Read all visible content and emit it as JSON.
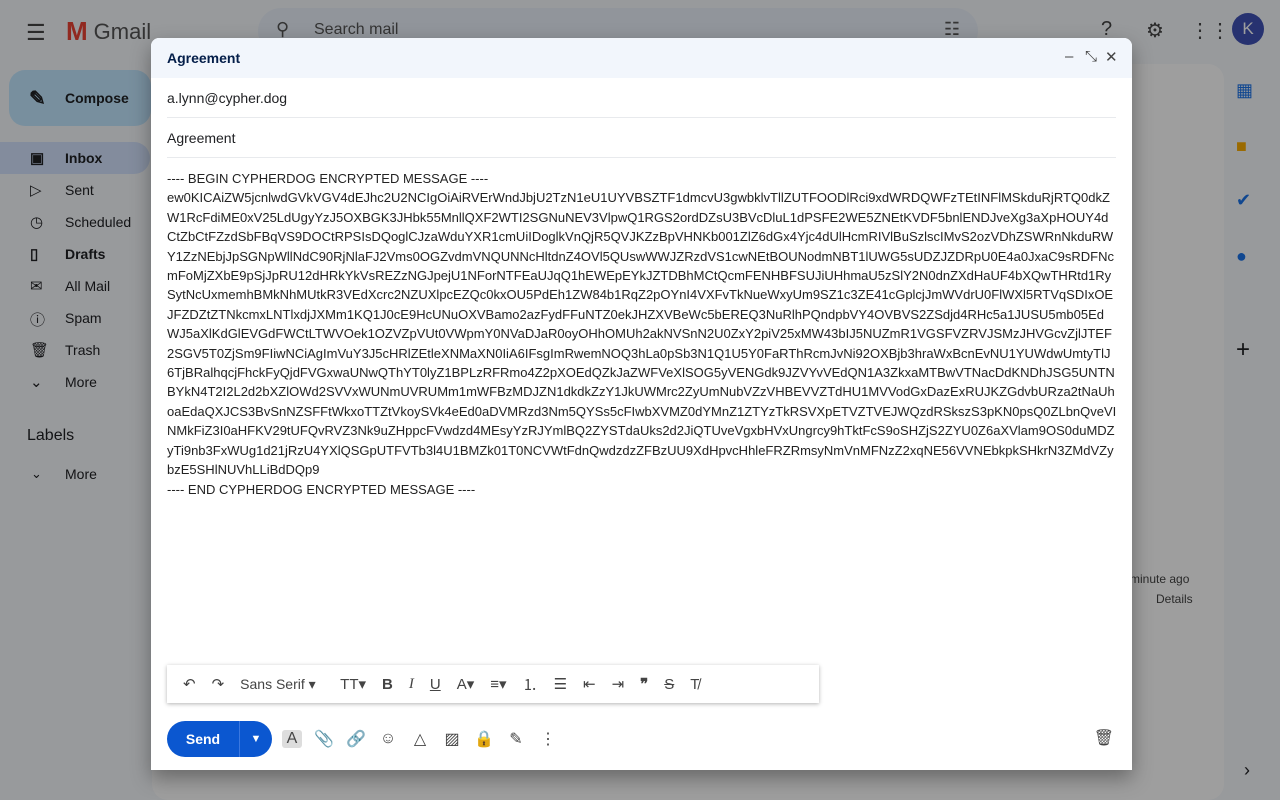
{
  "header": {
    "app_name": "Gmail",
    "search_placeholder": "Search mail",
    "avatar_letter": "K"
  },
  "sidebar": {
    "compose": "Compose",
    "items": [
      {
        "label": "Inbox",
        "icon": "inbox-icon"
      },
      {
        "label": "Sent",
        "icon": "send-icon"
      },
      {
        "label": "Scheduled",
        "icon": "schedule-icon"
      },
      {
        "label": "Drafts",
        "icon": "draft-icon"
      },
      {
        "label": "All Mail",
        "icon": "mail-icon"
      },
      {
        "label": "Spam",
        "icon": "spam-icon"
      },
      {
        "label": "Trash",
        "icon": "trash-icon"
      },
      {
        "label": "More",
        "icon": "chevron-down-icon"
      }
    ],
    "labels_title": "Labels",
    "labels_more": "More"
  },
  "background": {
    "time": "minute ago",
    "details": "Details"
  },
  "compose": {
    "title": "Agreement",
    "to": "a.lynn@cypher.dog",
    "subject": "Agreement",
    "body_begin": "---- BEGIN CYPHERDOG ENCRYPTED MESSAGE ----",
    "body_lines": [
      "ew0KICAiZW5jcnlwdGVkVGV4dEJhc2U2NCIgOiAiRVErWndJbjU2TzN1eU1UYVBSZTF1dmcvU3gwbklvTllZUTFOODlRci9xdWRDQWFzTEtINFlMSkduRjRTQ0dkZ",
      "W1RcFdiME0xV25LdUgyYzJ5OXBGK3JHbk55MnllQXF2WTI2SGNuNEV3VlpwQ1RGS2ordDZsU3BVcDluL1dPSFE2WE5ZNEtKVDF5bnlENDJveXg3aXpHOUY4d",
      "CtZbCtFZzdSbFBqVS9DOCtRPSIsDQoglCJzaWduYXR1cmUiIDoglkVnQjR5QVJKZzBpVHNKb001ZlZ6dGx4Yjc4dUlHcmRIVlBuSzlscIMvS2ozVDhZSWRnNkduRW",
      "Y1ZzNEbjJpSGNpWllNdC90RjNlaFJ2Vms0OGZvdmVNQUNNcHltdnZ4OVl5QUswWWJZRzdVS1cwNEtBOUNodmNBT1lUWG5sUDZJZDRpU0E4a0JxaC9sRDFNc",
      "mFoMjZXbE9pSjJpRU12dHRkYkVsREZzNGJpejU1NForNTFEaUJqQ1hEWEpEYkJZTDBhMCtQcmFENHBFSUJiUHhmaU5zSlY2N0dnZXdHaUF4bXQwTHRtd1Ry",
      "SytNcUxmemhBMkNhMUtkR3VEdXcrc2NZUXlpcEZQc0kxOU5PdEh1ZW84b1RqZ2pOYnI4VXFvTkNueWxyUm9SZ1c3ZE41cGplcjJmWVdrU0FlWXl5RTVqSDIxOE",
      "JFZDZtZTNkcmxLNTlxdjJXMm1KQ1J0cE9HcUNuOXVBamo2azFydFFuNTZ0ekJHZXVBeWc5bEREQ3NuRlhPQndpbVY4OVBVS2ZSdjd4RHc5a1JUSU5mb05Ed",
      "WJ5aXlKdGlEVGdFWCtLTWVOek1OZVZpVUt0VWpmY0NVaDJaR0oyOHhOMUh2akNVSnN2U0ZxY2piV25xMW43bIJ5NUZmR1VGSFVZRVJSMzJHVGcvZjlJTEF",
      "2SGV5T0ZjSm9FIiwNCiAgImVuY3J5cHRlZEtleXNMaXN0IiA6IFsgImRwemNOQ3hLa0pSb3N1Q1U5Y0FaRThRcmJvNi92OXBjb3hraWxBcnEvNU1YUWdwUmtyTlJ",
      "6TjBRalhqcjFhckFyQjdFVGxwaUNwQThYT0lyZ1BPLzRFRmo4Z2pXOEdQZkJaZWFVeXlSOG5yVENGdk9JZVYvVEdQN1A3ZkxaMTBwVTNacDdKNDhJSG5UNTN",
      "BYkN4T2I2L2d2bXZlOWd2SVVxWUNmUVRUMm1mWFBzMDJZN1dkdkZzY1JkUWMrc2ZyUmNubVZzVHBEVVZTdHU1MVVodGxDazExRUJKZGdvbURza2tNaUh",
      "oaEdaQXJCS3BvSnNZSFFtWkxoTTZtVkoySVk4eEd0aDVMRzd3Nm5QYSs5cFIwbXVMZ0dYMnZ1ZTYzTkRSVXpETVZTVEJWQzdRSkszS3pKN0psQ0ZLbnQveVI",
      "NMkFiZ3I0aHFKV29tUFQvRVZ3Nk9uZHppcFVwdzd4MEsyYzRJYmlBQ2ZYSTdaUks2d2JiQTUveVgxbHVxUngrcy9hTktFcS9oSHZjS2ZYU0Z6aXVlam9OS0duMDZ",
      "yTi9nb3FxWUg1d21jRzU4YXlQSGpUTFVTb3l4U1BMZk01T0NCVWtFdnQwdzdzZFBzUU9XdHpvcHhleFRZRmsyNmVnMFNzZ2xqNE56VVNEbkpkSHkrN3ZMdVZy",
      "bzE5SHlNUVhLLiBdDQp9"
    ],
    "body_end": "---- END CYPHERDOG ENCRYPTED MESSAGE ----",
    "font": "Sans Serif",
    "send": "Send"
  }
}
